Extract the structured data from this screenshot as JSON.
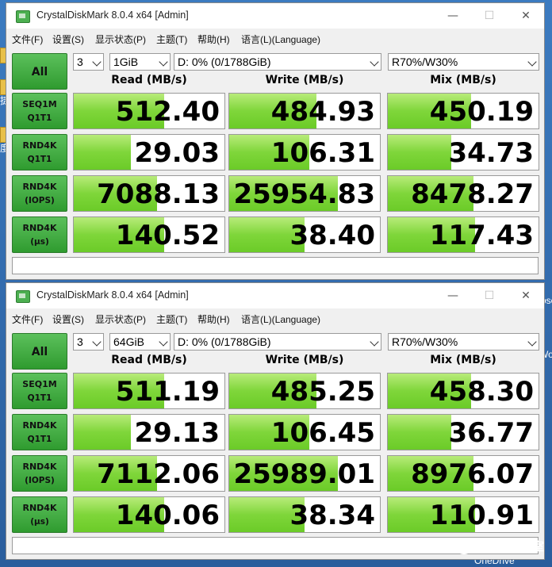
{
  "desktop": {
    "onedrive_label": "OneDrive",
    "side_char_1": "捷",
    "side_char_2": "度",
    "side_char_3": "rosc",
    "side_char_4": "Wo"
  },
  "watermark": {
    "text": "电脑吧评测室"
  },
  "windows": [
    {
      "title": "CrystalDiskMark 8.0.4 x64 [Admin]",
      "controls": {
        "minimize": "—",
        "maximize": "☐",
        "close": "✕"
      },
      "menu": [
        "文件(F)",
        "设置(S)",
        "显示状态(P)",
        "主题(T)",
        "帮助(H)",
        "语言(L)(Language)"
      ],
      "all_label": "All",
      "count": "3",
      "size": "1GiB",
      "drive": "D: 0% (0/1788GiB)",
      "mix_ratio": "R70%/W30%",
      "headers": [
        "Read (MB/s)",
        "Write (MB/s)",
        "Mix (MB/s)"
      ],
      "rows": [
        {
          "l1": "SEQ1M",
          "l2": "Q1T1",
          "read": "512.40",
          "write": "484.93",
          "mix": "450.19"
        },
        {
          "l1": "RND4K",
          "l2": "Q1T1",
          "read": "29.03",
          "write": "106.31",
          "mix": "34.73"
        },
        {
          "l1": "RND4K",
          "l2": "(IOPS)",
          "read": "7088.13",
          "write": "25954.83",
          "mix": "8478.27"
        },
        {
          "l1": "RND4K",
          "l2": "(μs)",
          "read": "140.52",
          "write": "38.40",
          "mix": "117.43"
        }
      ],
      "fills": [
        [
          0.6,
          0.58,
          0.55
        ],
        [
          0.38,
          0.53,
          0.42
        ],
        [
          0.55,
          0.72,
          0.57
        ],
        [
          0.6,
          0.5,
          0.58
        ]
      ]
    },
    {
      "title": "CrystalDiskMark 8.0.4 x64 [Admin]",
      "controls": {
        "minimize": "—",
        "maximize": "☐",
        "close": "✕"
      },
      "menu": [
        "文件(F)",
        "设置(S)",
        "显示状态(P)",
        "主题(T)",
        "帮助(H)",
        "语言(L)(Language)"
      ],
      "all_label": "All",
      "count": "3",
      "size": "64GiB",
      "drive": "D: 0% (0/1788GiB)",
      "mix_ratio": "R70%/W30%",
      "headers": [
        "Read (MB/s)",
        "Write (MB/s)",
        "Mix (MB/s)"
      ],
      "rows": [
        {
          "l1": "SEQ1M",
          "l2": "Q1T1",
          "read": "511.19",
          "write": "485.25",
          "mix": "458.30"
        },
        {
          "l1": "RND4K",
          "l2": "Q1T1",
          "read": "29.13",
          "write": "106.45",
          "mix": "36.77"
        },
        {
          "l1": "RND4K",
          "l2": "(IOPS)",
          "read": "7112.06",
          "write": "25989.01",
          "mix": "8976.07"
        },
        {
          "l1": "RND4K",
          "l2": "(μs)",
          "read": "140.06",
          "write": "38.34",
          "mix": "110.91"
        }
      ],
      "fills": [
        [
          0.6,
          0.58,
          0.55
        ],
        [
          0.38,
          0.53,
          0.42
        ],
        [
          0.55,
          0.72,
          0.57
        ],
        [
          0.6,
          0.5,
          0.58
        ]
      ]
    }
  ]
}
